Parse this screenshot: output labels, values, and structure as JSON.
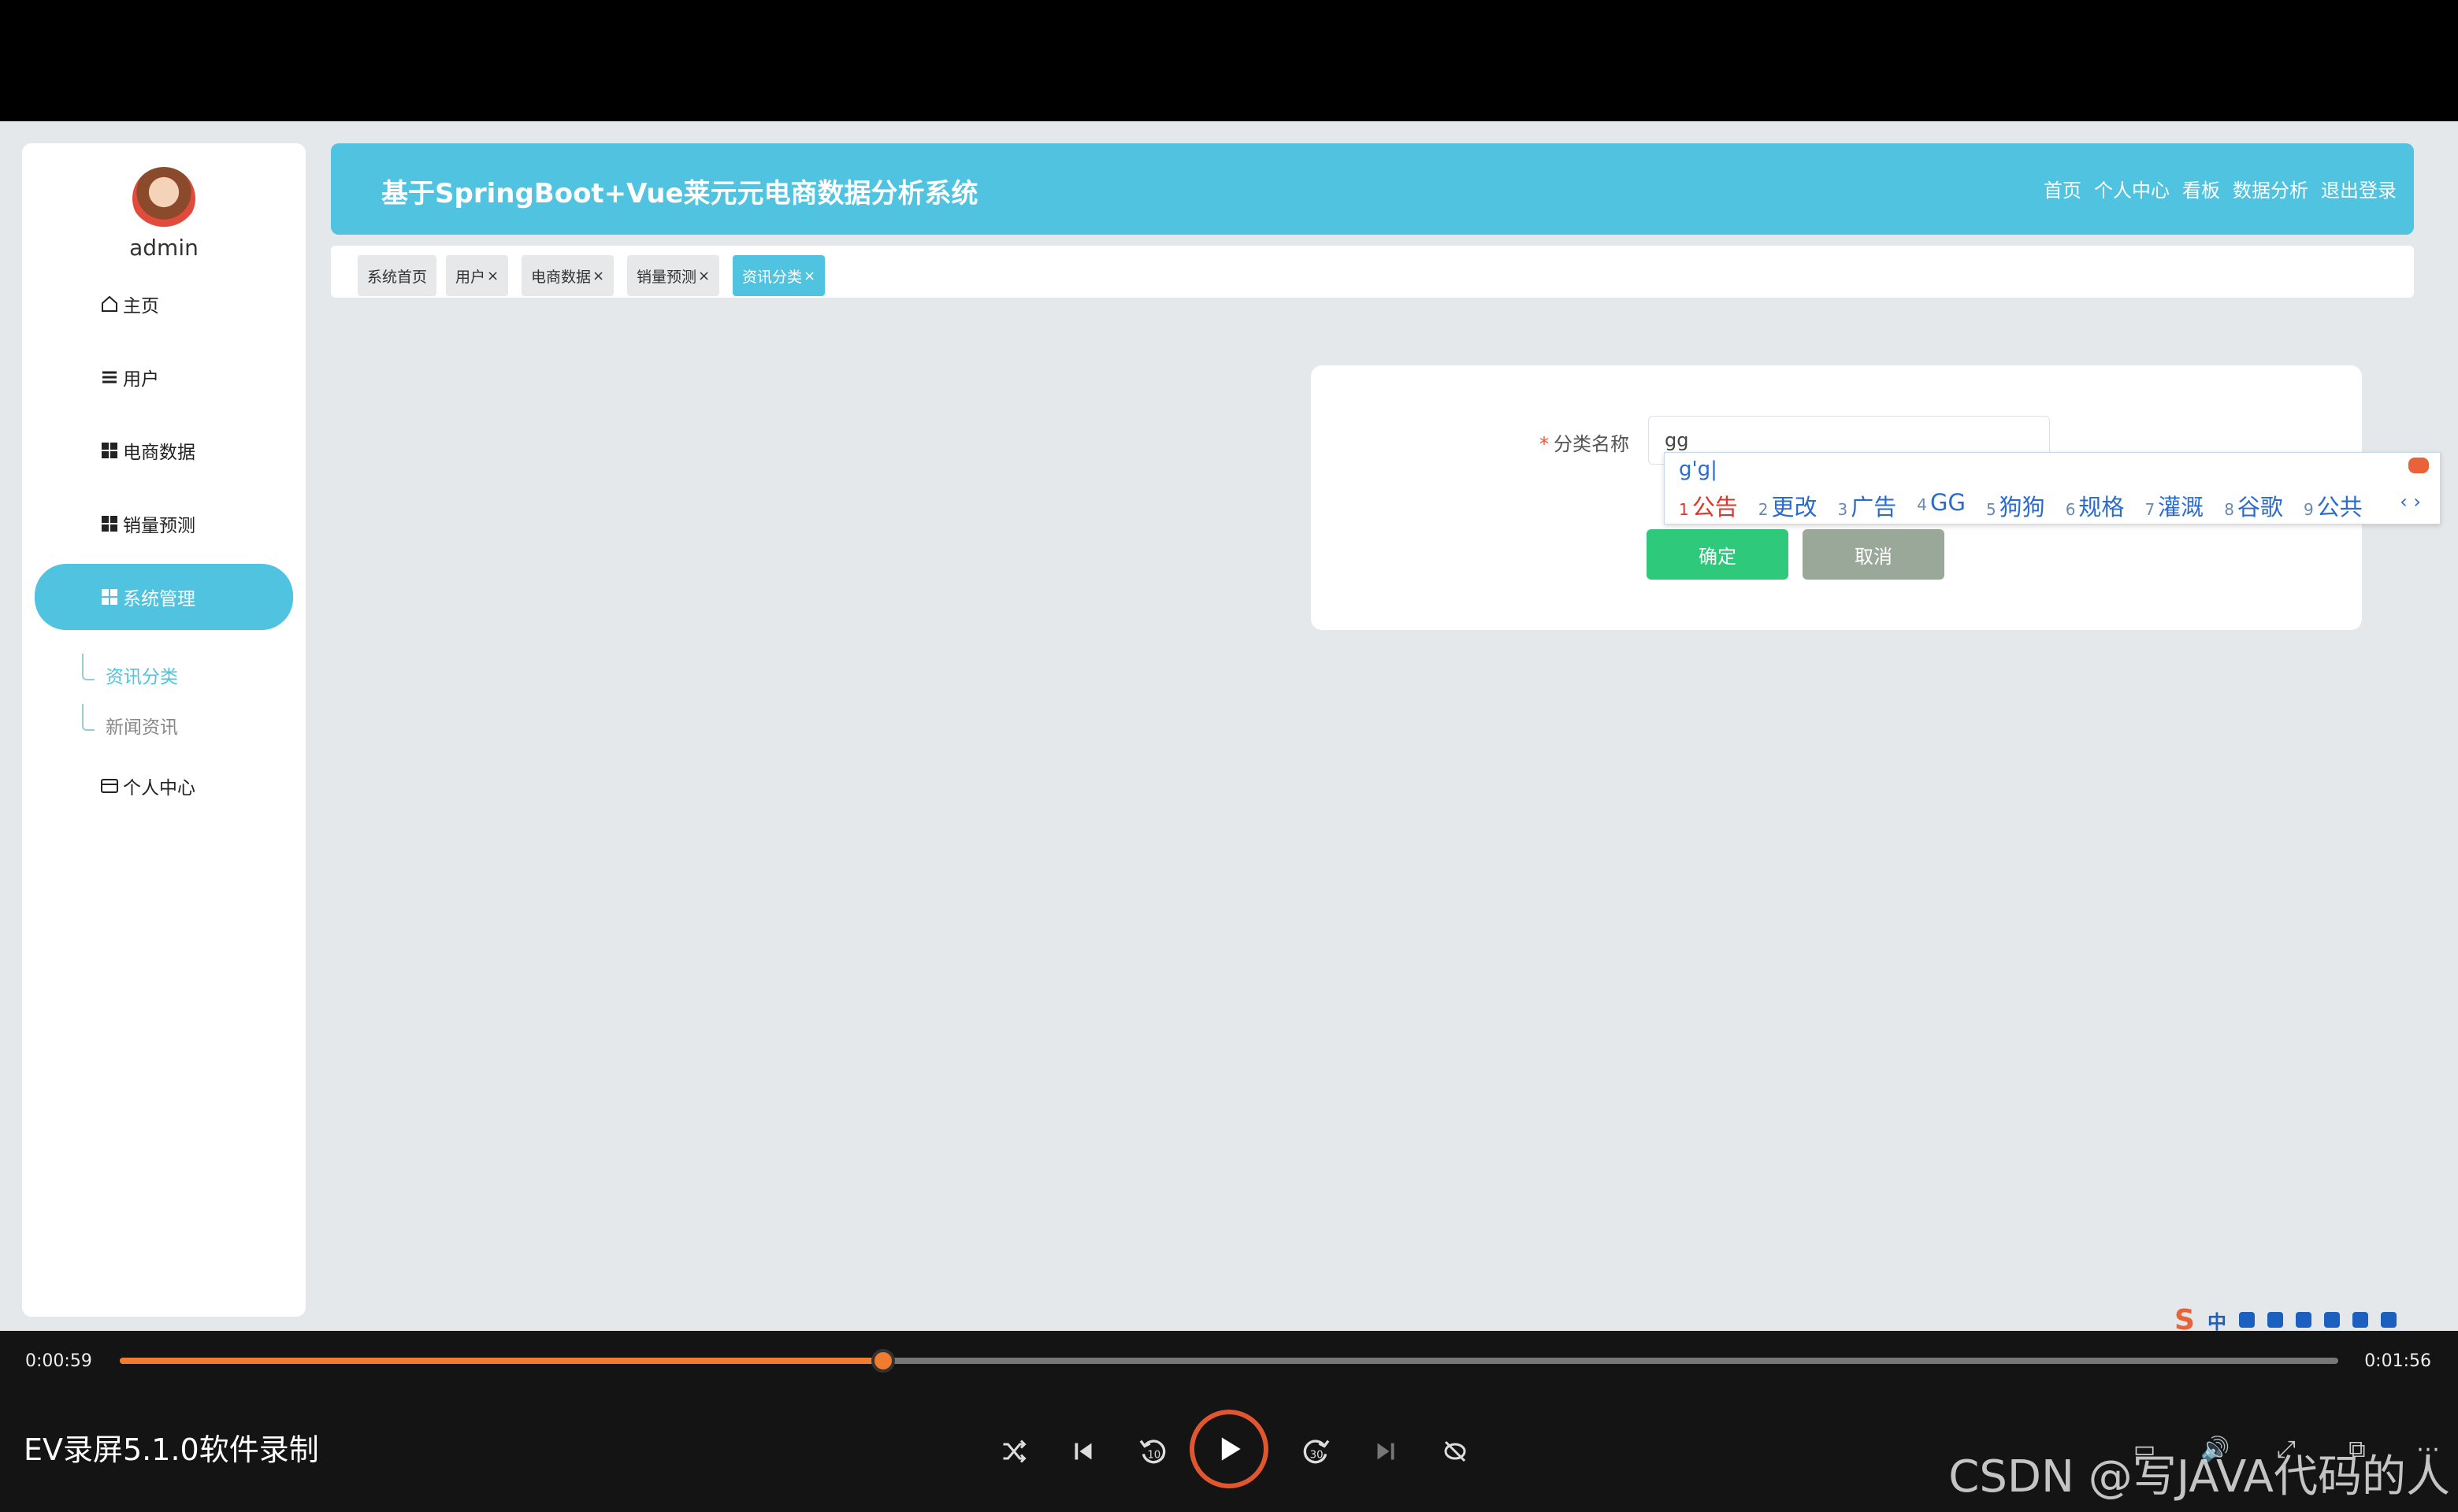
{
  "sidebar": {
    "username": "admin",
    "items": [
      {
        "label": "主页",
        "icon": "home-icon"
      },
      {
        "label": "用户",
        "icon": "list-icon"
      },
      {
        "label": "电商数据",
        "icon": "grid-icon"
      },
      {
        "label": "销量预测",
        "icon": "grid-icon"
      },
      {
        "label": "系统管理",
        "icon": "grid-icon"
      },
      {
        "label": "个人中心",
        "icon": "card-icon"
      }
    ],
    "subitems": [
      {
        "label": "资讯分类"
      },
      {
        "label": "新闻资讯"
      }
    ]
  },
  "header": {
    "title": "基于SpringBoot+Vue莱元元电商数据分析系统",
    "nav": [
      "首页",
      "个人中心",
      "看板",
      "数据分析",
      "退出登录"
    ]
  },
  "tabs": [
    "系统首页",
    "用户",
    "电商数据",
    "销量预测",
    "资讯分类"
  ],
  "form": {
    "required_mark": "*",
    "label": "分类名称",
    "input_value": "gg",
    "confirm_label": "确定",
    "cancel_label": "取消"
  },
  "ime": {
    "composition": "g'g|",
    "candidates": [
      {
        "n": "1",
        "text": "公告"
      },
      {
        "n": "2",
        "text": "更改"
      },
      {
        "n": "3",
        "text": "广告"
      },
      {
        "n": "4",
        "text": "GG"
      },
      {
        "n": "5",
        "text": "狗狗"
      },
      {
        "n": "6",
        "text": "规格"
      },
      {
        "n": "7",
        "text": "灌溉"
      },
      {
        "n": "8",
        "text": "谷歌"
      },
      {
        "n": "9",
        "text": "公共"
      }
    ],
    "toolbar_lang": "中"
  },
  "player": {
    "current_time": "0:00:59",
    "total_time": "0:01:56",
    "progress": 0.344,
    "title": "EV录屏5.1.0软件录制",
    "rewind_label": "10",
    "forward_label": "30"
  },
  "watermark": "CSDN @写JAVA代码的人",
  "colors": {
    "accent": "#4fc3df",
    "confirm": "#2ec97a",
    "cancel": "#9aa89a",
    "progress": "#f07d2f"
  }
}
